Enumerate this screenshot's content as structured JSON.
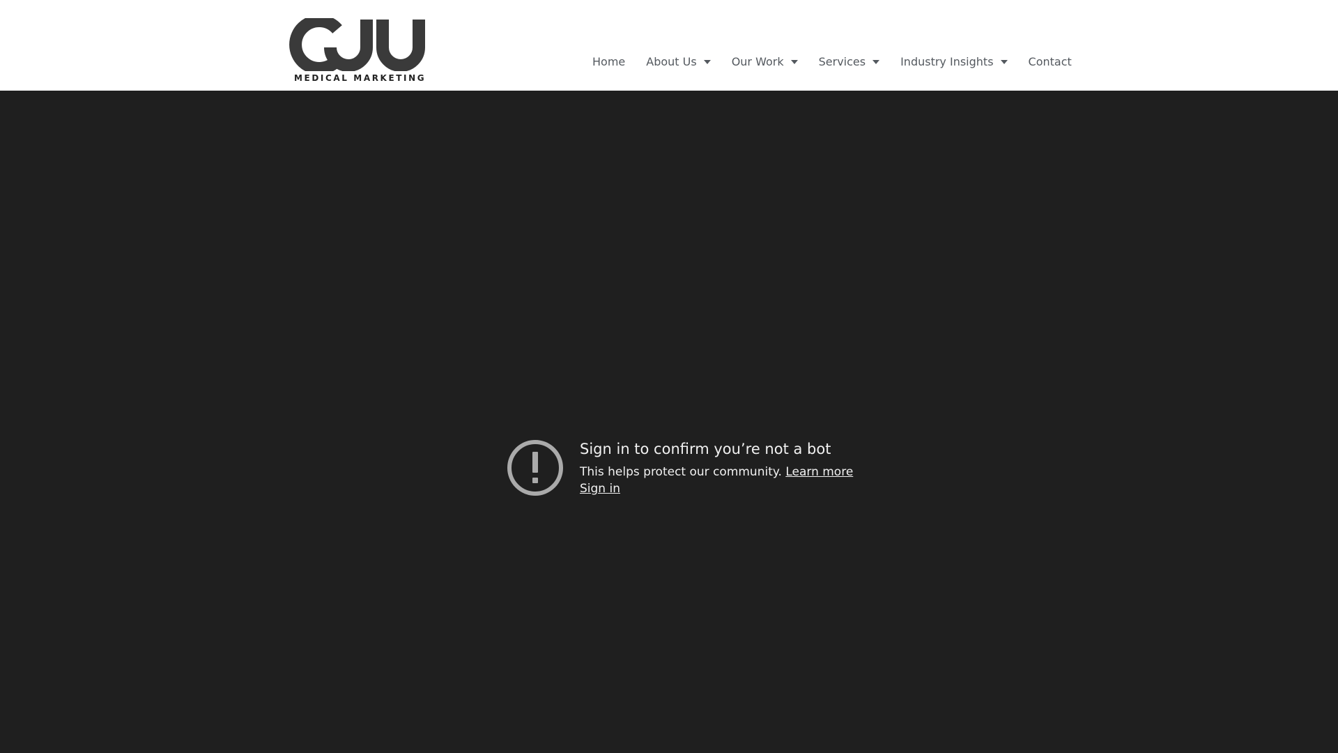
{
  "brand": {
    "logo_letters": "CJU",
    "tagline": "MEDICAL MARKETING"
  },
  "nav": {
    "items": [
      {
        "label": "Home",
        "dropdown": false
      },
      {
        "label": "About Us",
        "dropdown": true
      },
      {
        "label": "Our Work",
        "dropdown": true
      },
      {
        "label": "Services",
        "dropdown": true
      },
      {
        "label": "Industry Insights",
        "dropdown": true
      },
      {
        "label": "Contact",
        "dropdown": false
      }
    ]
  },
  "video_notice": {
    "icon": "alert-circle-icon",
    "title": "Sign in to confirm you’re not a bot",
    "message": "This helps protect our community.",
    "learn_more_label": "Learn more",
    "sign_in_label": "Sign in"
  },
  "colors": {
    "header_bg": "#ffffff",
    "nav_text": "#54595f",
    "logo_dark": "#3a3a3a",
    "player_bg": "#1f1f1f",
    "notice_text": "#f1f1f1",
    "icon_gray": "#aaaaaa"
  }
}
